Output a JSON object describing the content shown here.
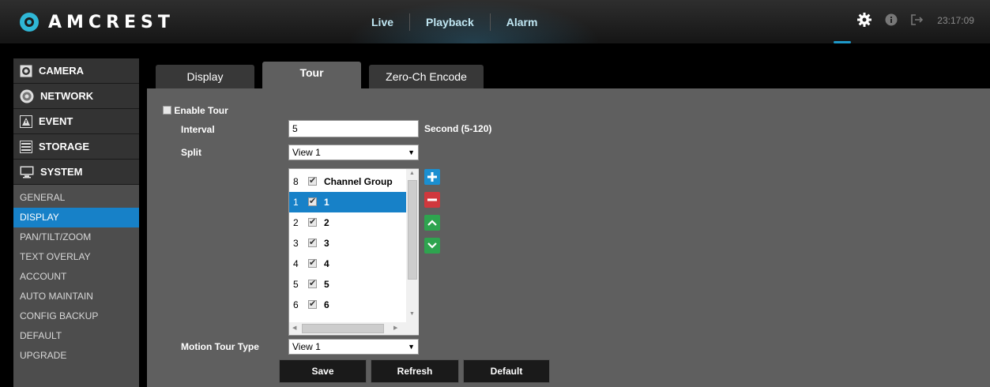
{
  "brand": {
    "name": "AMCREST"
  },
  "nav": {
    "items": [
      "Live",
      "Playback",
      "Alarm"
    ]
  },
  "topright": {
    "time": "23:17:09"
  },
  "sidebar": {
    "sections": [
      {
        "label": "CAMERA",
        "icon": "camera-icon"
      },
      {
        "label": "NETWORK",
        "icon": "network-icon"
      },
      {
        "label": "EVENT",
        "icon": "event-icon"
      },
      {
        "label": "STORAGE",
        "icon": "storage-icon"
      },
      {
        "label": "SYSTEM",
        "icon": "system-icon"
      }
    ],
    "subitems": [
      "GENERAL",
      "DISPLAY",
      "PAN/TILT/ZOOM",
      "TEXT OVERLAY",
      "ACCOUNT",
      "AUTO MAINTAIN",
      "CONFIG BACKUP",
      "DEFAULT",
      "UPGRADE"
    ],
    "active_subitem": "DISPLAY"
  },
  "tabs": [
    "Display",
    "Tour",
    "Zero-Ch Encode"
  ],
  "active_tab": "Tour",
  "form": {
    "enable_tour_label": "Enable Tour",
    "enable_tour_checked": false,
    "interval_label": "Interval",
    "interval_value": "5",
    "interval_hint": "Second (5-120)",
    "split_label": "Split",
    "split_value": "View 1",
    "motion_tour_type_label": "Motion Tour Type",
    "motion_tour_type_value": "View 1"
  },
  "channel_list": {
    "header": {
      "num": "8",
      "name": "Channel Group"
    },
    "rows": [
      {
        "num": "1",
        "name": "1",
        "selected": true
      },
      {
        "num": "2",
        "name": "2",
        "selected": false
      },
      {
        "num": "3",
        "name": "3",
        "selected": false
      },
      {
        "num": "4",
        "name": "4",
        "selected": false
      },
      {
        "num": "5",
        "name": "5",
        "selected": false
      },
      {
        "num": "6",
        "name": "6",
        "selected": false
      }
    ]
  },
  "buttons": {
    "save": "Save",
    "refresh": "Refresh",
    "default": "Default"
  },
  "colors": {
    "accent": "#1781c8",
    "add": "#1b8fd0",
    "remove": "#d0383d",
    "move": "#2ea44f",
    "brand": "#2fb7d6"
  }
}
